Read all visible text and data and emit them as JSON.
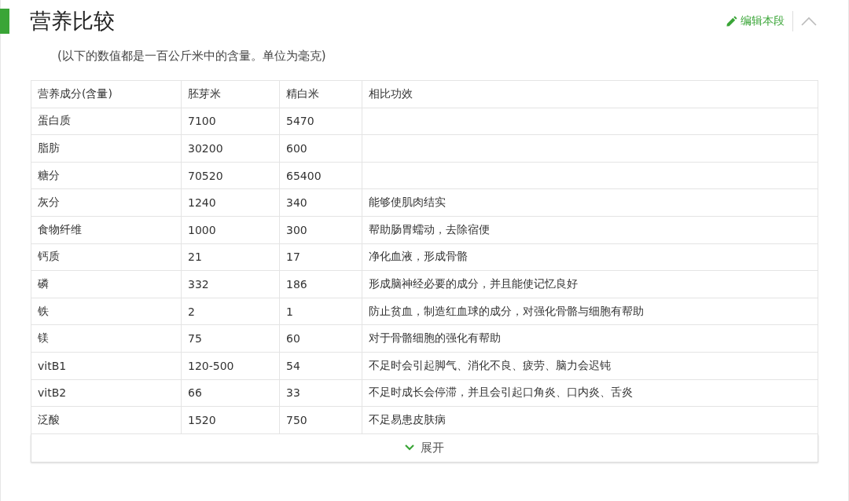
{
  "section": {
    "title": "营养比较",
    "edit_link": "编辑本段"
  },
  "note": "(以下的数值都是一百公斤米中的含量。单位为毫克)",
  "table": {
    "columns": [
      "营养成分(含量)",
      "胚芽米",
      "精白米",
      "相比功效"
    ],
    "rows": [
      [
        "蛋白质",
        "7100",
        "5470",
        ""
      ],
      [
        "脂肪",
        "30200",
        "600",
        ""
      ],
      [
        "糖分",
        "70520",
        "65400",
        ""
      ],
      [
        "灰分",
        "1240",
        "340",
        "能够使肌肉结实"
      ],
      [
        "食物纤维",
        "1000",
        "300",
        "帮助肠胃蠕动，去除宿便"
      ],
      [
        "钙质",
        "21",
        "17",
        "净化血液，形成骨骼"
      ],
      [
        "磷",
        "332",
        "186",
        "形成脑神经必要的成分，并且能使记忆良好"
      ],
      [
        "铁",
        "2",
        "1",
        "防止贫血，制造红血球的成分，对强化骨骼与细胞有帮助"
      ],
      [
        "镁",
        "75",
        "60",
        "对于骨骼细胞的强化有帮助"
      ],
      [
        "vitB1",
        "120-500",
        "54",
        "不足时会引起脚气、消化不良、疲劳、脑力会迟钝"
      ],
      [
        "vitB2",
        "66",
        "33",
        "不足时成长会停滞，并且会引起口角炎、口内炎、舌炎"
      ],
      [
        "泛酸",
        "1520",
        "750",
        "不足易患皮肤病"
      ]
    ]
  },
  "expand_button": {
    "label": "展开"
  }
}
